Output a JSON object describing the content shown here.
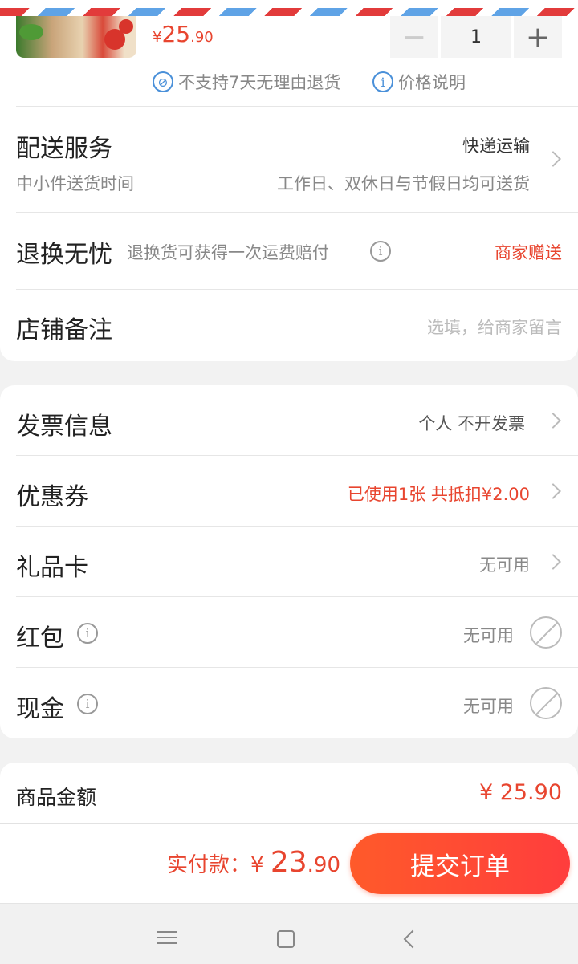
{
  "product": {
    "currency": "¥",
    "price_int": "25",
    "price_dec": ".90",
    "quantity": "1",
    "minus_label": "−",
    "plus_label": "+"
  },
  "notices": {
    "no_return_icon": "⊘",
    "no_return": "不支持7天无理由退货",
    "price_info_icon": "i",
    "price_info": "价格说明"
  },
  "delivery": {
    "title": "配送服务",
    "method": "快递运输",
    "sub_left": "中小件送货时间",
    "sub_right": "工作日、双休日与节假日均可送货"
  },
  "return_worry": {
    "title": "退换无忧",
    "desc": "退换货可获得一次运费赔付",
    "status": "商家赠送"
  },
  "note": {
    "title": "店铺备注",
    "placeholder": "选填，给商家留言"
  },
  "invoice": {
    "title": "发票信息",
    "value": "个人 不开发票"
  },
  "coupon": {
    "title": "优惠券",
    "value": "已使用1张 共抵扣¥2.00"
  },
  "gift_card": {
    "title": "礼品卡",
    "value": "无可用"
  },
  "red_packet": {
    "title": "红包",
    "value": "无可用"
  },
  "cash": {
    "title": "现金",
    "value": "无可用"
  },
  "summary": {
    "goods_amount_label": "商品金额",
    "goods_amount_value": "¥ 25.90"
  },
  "footer": {
    "pay_label": "实付款：",
    "pay_currency": "¥ ",
    "pay_int": "23",
    "pay_dec": ".90",
    "submit": "提交订单"
  },
  "colors": {
    "accent_red": "#e8452f",
    "info_blue": "#4a90d9"
  }
}
